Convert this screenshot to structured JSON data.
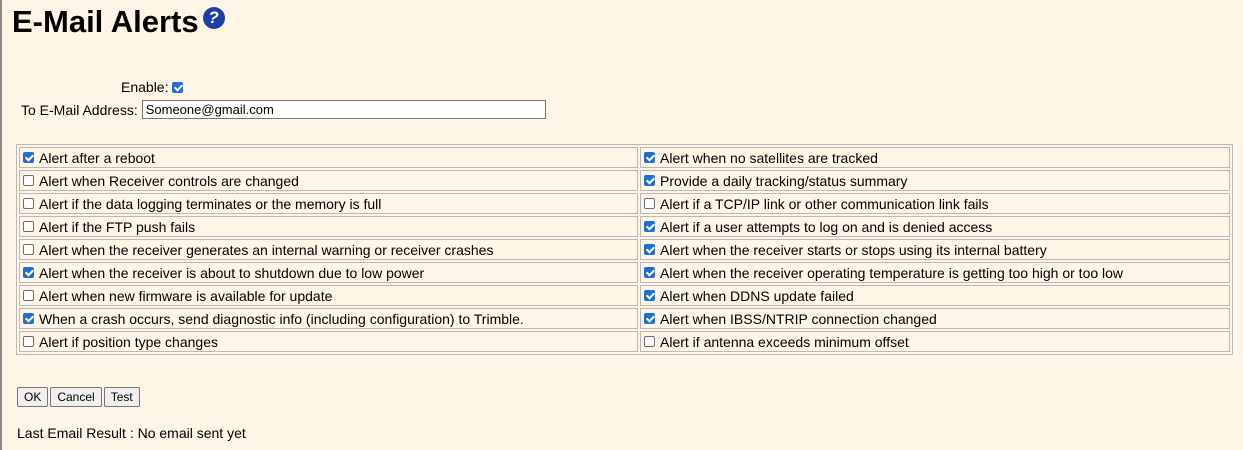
{
  "page": {
    "title": "E-Mail Alerts",
    "help_icon": "help-circle-icon"
  },
  "form": {
    "enable_label": "Enable:",
    "enable_checked": true,
    "email_label": "To E-Mail Address:",
    "email_value": "Someone@gmail.com"
  },
  "alerts": {
    "left": [
      {
        "label": "Alert after a reboot",
        "checked": true
      },
      {
        "label": "Alert when Receiver controls are changed",
        "checked": false
      },
      {
        "label": "Alert if the data logging terminates or the memory is full",
        "checked": false
      },
      {
        "label": "Alert if the FTP push fails",
        "checked": false
      },
      {
        "label": "Alert when the receiver generates an internal warning or receiver crashes",
        "checked": false
      },
      {
        "label": "Alert when the receiver is about to shutdown due to low power",
        "checked": true
      },
      {
        "label": "Alert when new firmware is available for update",
        "checked": false
      },
      {
        "label": "When a crash occurs, send diagnostic info (including configuration) to Trimble.",
        "checked": true
      },
      {
        "label": "Alert if position type changes",
        "checked": false
      }
    ],
    "right": [
      {
        "label": "Alert when no satellites are tracked",
        "checked": true
      },
      {
        "label": "Provide a daily tracking/status summary",
        "checked": true
      },
      {
        "label": "Alert if a TCP/IP link or other communication link fails",
        "checked": false
      },
      {
        "label": "Alert if a user attempts to log on and is denied access",
        "checked": true
      },
      {
        "label": "Alert when the receiver starts or stops using its internal battery",
        "checked": true
      },
      {
        "label": "Alert when the receiver operating temperature is getting too high or too low",
        "checked": true
      },
      {
        "label": "Alert when DDNS update failed",
        "checked": true
      },
      {
        "label": "Alert when IBSS/NTRIP connection changed",
        "checked": true
      },
      {
        "label": "Alert if antenna exceeds minimum offset",
        "checked": false
      }
    ]
  },
  "buttons": {
    "ok": "OK",
    "cancel": "Cancel",
    "test": "Test"
  },
  "status": {
    "last_result": "Last Email Result : No email sent yet"
  }
}
